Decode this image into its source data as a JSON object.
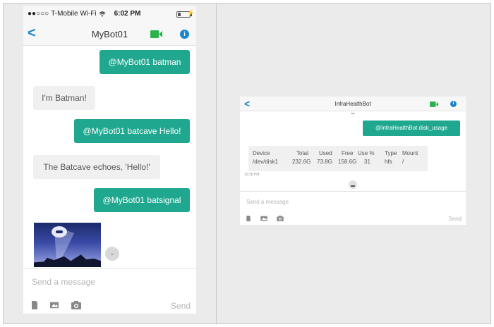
{
  "colors": {
    "accent": "#1fa88f",
    "link": "#1a86c9",
    "video": "#2bb24c",
    "incoming_bg": "#f0f0f0"
  },
  "phone": {
    "status": {
      "signal": "●●○○○",
      "carrier": "T-Mobile Wi-Fi",
      "wifi": "wifi-icon",
      "time": "6:02 PM",
      "battery": "battery-icon"
    },
    "nav": {
      "back_icon": "chevron-left-icon",
      "title": "MyBot01",
      "video_icon": "video-camera-icon",
      "info_icon": "info-icon",
      "info_glyph": "i"
    },
    "messages": [
      {
        "dir": "out",
        "text": "@MyBot01 batman"
      },
      {
        "dir": "in",
        "text": "I'm Batman!"
      },
      {
        "dir": "out",
        "text": "@MyBot01 batcave Hello!"
      },
      {
        "dir": "in",
        "text": "The Batcave echoes, 'Hello!'"
      },
      {
        "dir": "out",
        "text": "@MyBot01 batsignal"
      }
    ],
    "image": "bat-signal-image",
    "compose": {
      "placeholder": "Send a message",
      "send": "Send",
      "icons": [
        "file-icon",
        "image-icon",
        "camera-icon"
      ]
    }
  },
  "tablet": {
    "nav": {
      "title": "InfraHealthBot",
      "info_glyph": "i"
    },
    "message_out": "@InfraHealthBot disk_usage",
    "disk_table": {
      "headers": [
        "Device",
        "Total",
        "Used",
        "Free",
        "Use %",
        "Type",
        "Mount"
      ],
      "row": [
        "/dev/disk1",
        "232.6G",
        "73.8G",
        "158.6G",
        "31",
        "hfs",
        "/"
      ]
    },
    "timestamp": "10:28 PM",
    "compose": {
      "placeholder": "Send a message",
      "send": "Send"
    }
  }
}
